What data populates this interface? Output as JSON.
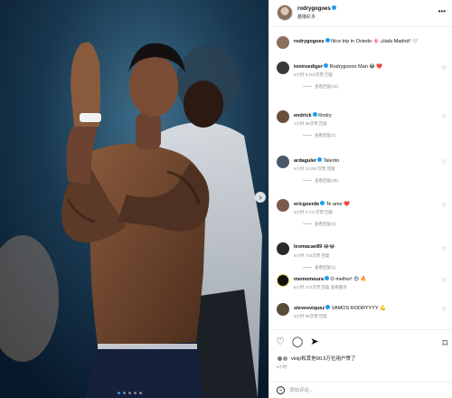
{
  "post": {
    "username": "rodrygogoes",
    "subtitle": "趣播彩多",
    "photo_page": 1,
    "photo_count": 5
  },
  "comments": [
    {
      "user": "rodrygogoes",
      "text": "Nice trip in Oviedo 🌸 ¡Hala Madrid! 🤍",
      "meta": "",
      "replies": "",
      "avatar_color": "#8a6f5b"
    },
    {
      "user": "toniruediger",
      "text": "Rodrygoooo Man 😂 ❤️",
      "meta": "6小时   5,153次赞   回复",
      "replies": "查看回复(19)",
      "avatar_color": "#3a3a3a"
    },
    {
      "user": "endrick",
      "text": "Rodry",
      "meta": "1小时   36次赞   回复",
      "replies": "查看回复(2)",
      "avatar_color": "#6b4e3d"
    },
    {
      "user": "ardaguler",
      "text": "Talento",
      "meta": "6小时   14,067次赞   回复",
      "replies": "查看回复(29)",
      "avatar_color": "#4a5a6a"
    },
    {
      "user": "ericgoerde",
      "text": "Te amo ❤️",
      "meta": "6小时   4,717次赞   回复",
      "replies": "查看回复(3)",
      "avatar_color": "#7a5a4a"
    },
    {
      "user": "leomacae89",
      "text": "😂😂",
      "meta": "6小时   734次赞   回复",
      "replies": "查看回复(1)",
      "avatar_color": "#2a2a2a"
    },
    {
      "user": "memomoura",
      "text": "O melhor! 😍 🔥",
      "meta": "6小时   172次赞   回复   查看翻译",
      "replies": "",
      "avatar_color": "#111111"
    },
    {
      "user": "steveeviquez",
      "text": "VAMOS RODRYYYY 💪",
      "meta": "6小时   98次赞   回复",
      "replies": "",
      "avatar_color": "#5a4a3a"
    }
  ],
  "footer": {
    "likes_text": "vinijr和其他90.5万位用户赞了",
    "date": "6小时",
    "comment_placeholder": "添加评论..."
  },
  "icons": {
    "like": "heart-icon",
    "comment": "comment-icon",
    "share": "send-icon",
    "save": "bookmark-icon",
    "more": "more-icon"
  },
  "colors": {
    "verified": "#1d9bf0",
    "meta_gray": "#8e8e8e"
  }
}
